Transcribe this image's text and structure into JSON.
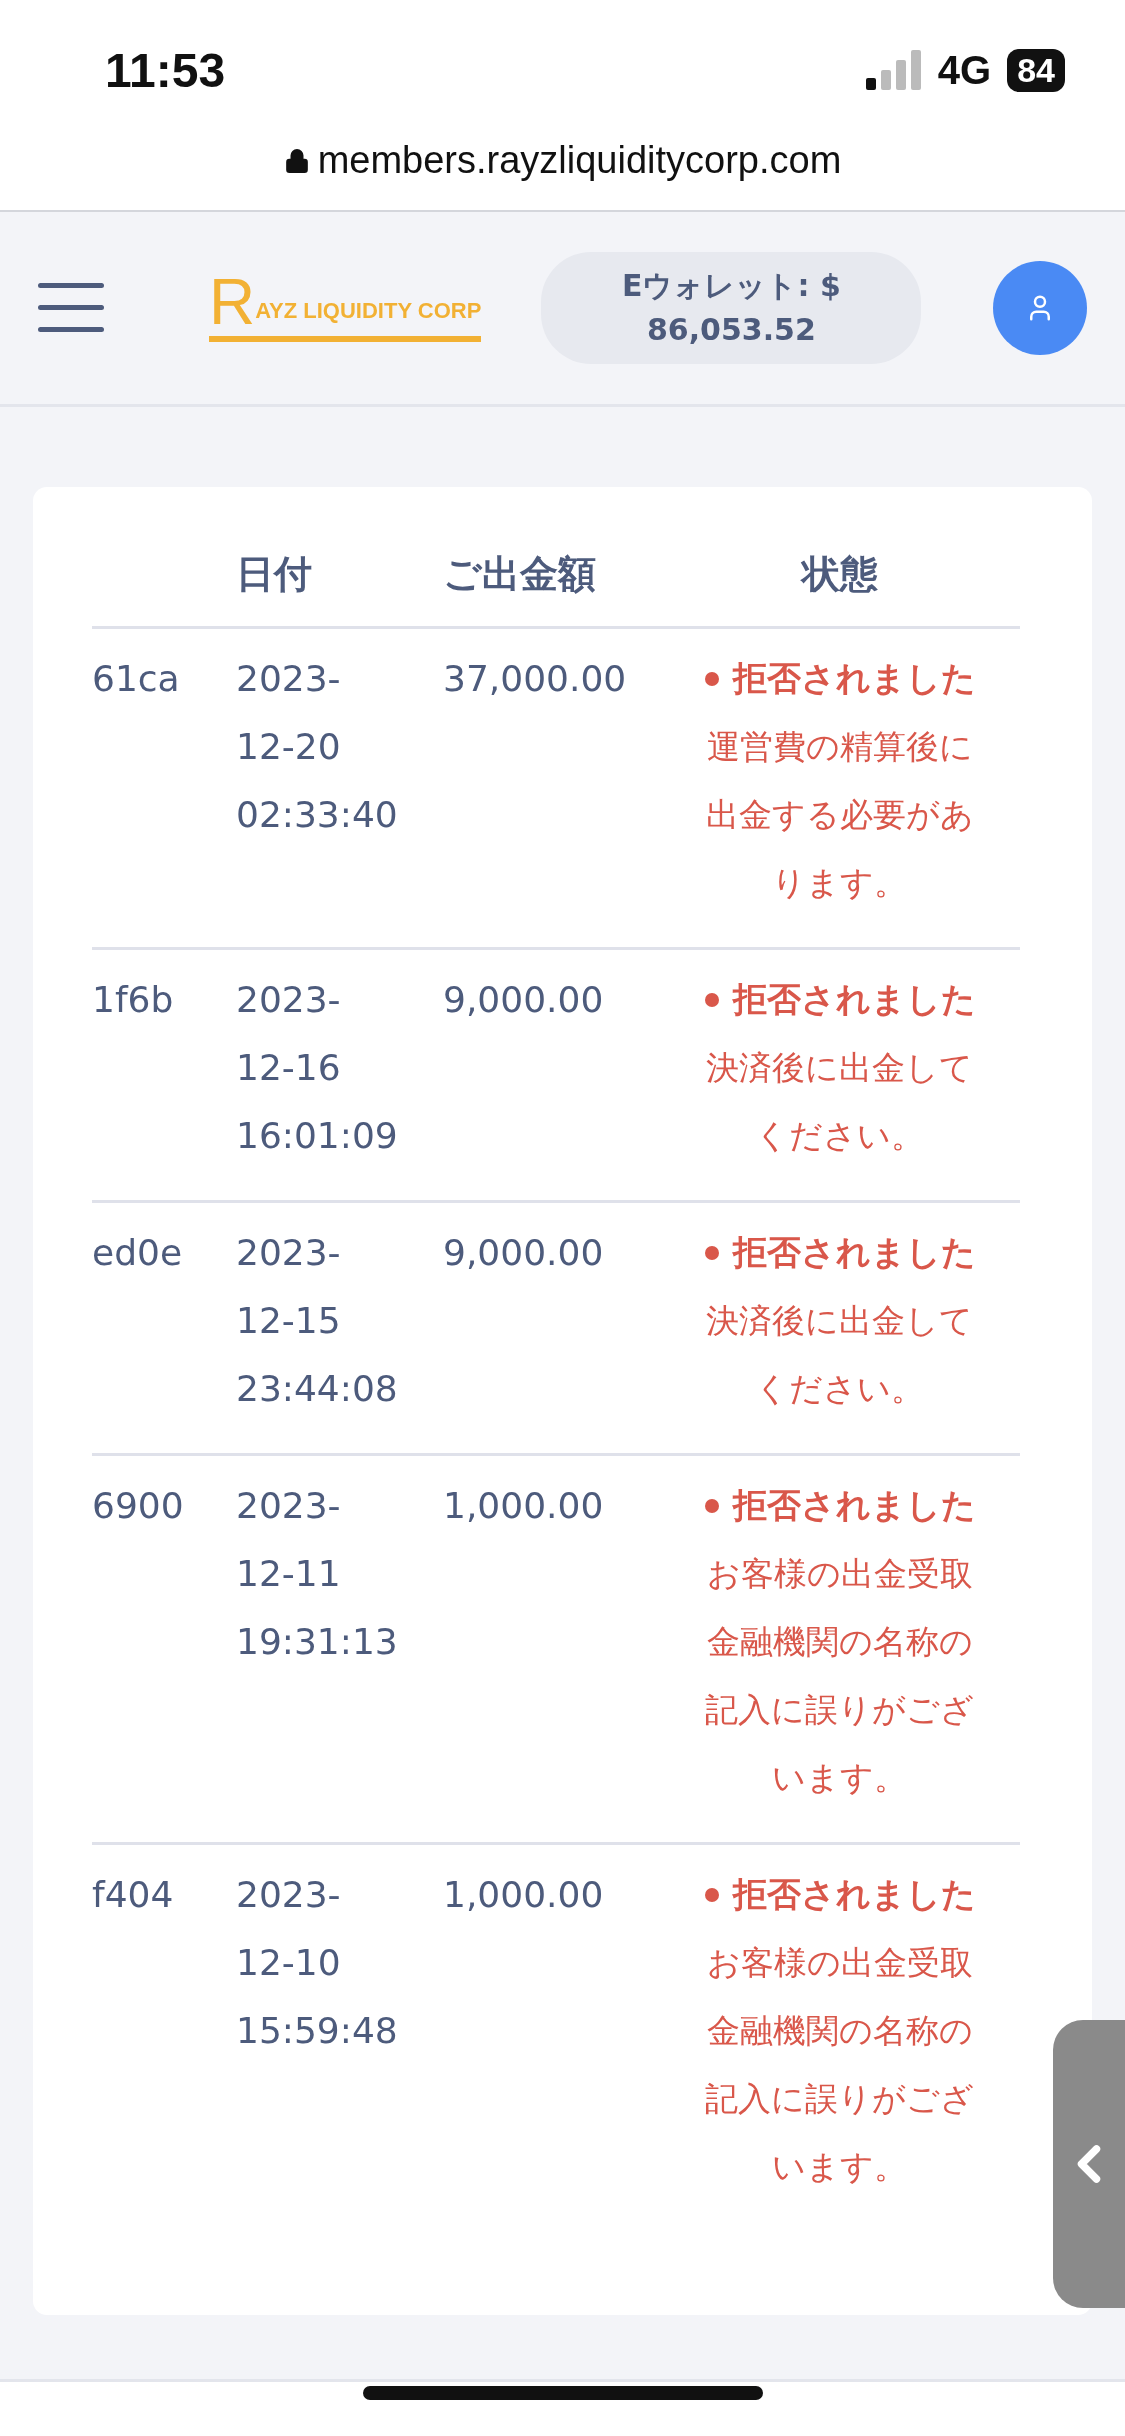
{
  "status_bar": {
    "time": "11:53",
    "network": "4G",
    "battery": "84"
  },
  "address_bar": {
    "url": "members.rayzliquiditycorp.com"
  },
  "header": {
    "logo": {
      "initial": "R",
      "rest": "AYZ LIQUIDITY CORP"
    },
    "wallet_label": "Eウォレット: $",
    "wallet_amount": "86,053.52"
  },
  "table": {
    "columns": [
      "日付",
      "ご出金額",
      "状態"
    ],
    "rows": [
      {
        "id": "61ca",
        "date": "2023-12-20 02:33:40",
        "amount": "37,000.00",
        "status": {
          "kind": "rejected",
          "label": "拒否されました",
          "message": "運営費の精算後に出金する必要があります。"
        }
      },
      {
        "id": "1f6b",
        "date": "2023-12-16 16:01:09",
        "amount": "9,000.00",
        "status": {
          "kind": "rejected",
          "label": "拒否されました",
          "message": "決済後に出金してください。"
        }
      },
      {
        "id": "ed0e",
        "date": "2023-12-15 23:44:08",
        "amount": "9,000.00",
        "status": {
          "kind": "rejected",
          "label": "拒否されました",
          "message": "決済後に出金してください。"
        }
      },
      {
        "id": "6900",
        "date": "2023-12-11 19:31:13",
        "amount": "1,000.00",
        "status": {
          "kind": "rejected",
          "label": "拒否されました",
          "message": "お客様の出金受取金融機関の名称の記入に誤りがございます。"
        }
      },
      {
        "id": "f404",
        "date": "2023-12-10 15:59:48",
        "amount": "1,000.00",
        "status": {
          "kind": "rejected",
          "label": "拒否されました",
          "message": "お客様の出金受取金融機関の名称の記入に誤りがございます。"
        }
      }
    ]
  }
}
